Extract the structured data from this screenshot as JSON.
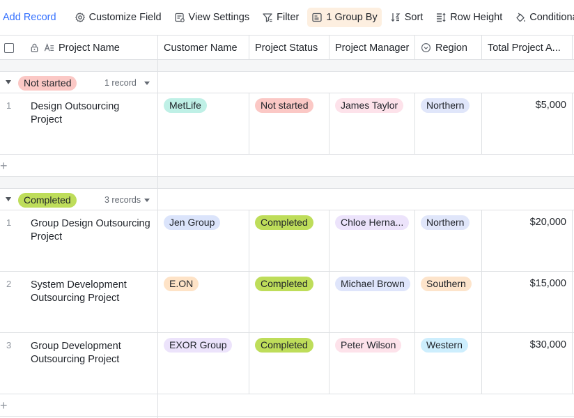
{
  "toolbar": {
    "add_record": "Add Record",
    "items": [
      {
        "label": "Customize Field",
        "icon": "gear-icon"
      },
      {
        "label": "View Settings",
        "icon": "view-settings-icon"
      },
      {
        "label": "Filter",
        "icon": "filter-icon"
      },
      {
        "label": "1 Group By",
        "icon": "group-icon",
        "active": true
      },
      {
        "label": "Sort",
        "icon": "sort-icon"
      },
      {
        "label": "Row Height",
        "icon": "row-height-icon"
      },
      {
        "label": "Conditional C",
        "icon": "paint-bucket-icon"
      }
    ]
  },
  "columns": [
    "Project Name",
    "Customer Name",
    "Project Status",
    "Project Manager",
    "Region",
    "Total Project A..."
  ],
  "colors": {
    "accent": "#3370ff",
    "not_started": "#fbc8c5",
    "completed": "#bedd5a",
    "metlife": "#bff0e6",
    "jen": "#dbe4fb",
    "eon": "#fee3c7",
    "exor": "#ece3fb",
    "person_pink": "#fde2ea",
    "person_blue": "#dfe5fb",
    "northern": "#e0e6fa",
    "southern": "#fde4cb",
    "western": "#cdeefd",
    "group_active_bg": "#fdefe0"
  },
  "groups": [
    {
      "label": "Not started",
      "count": "1 record",
      "rows": [
        {
          "num": "1",
          "name": "Design Outsourcing Project",
          "customer": "MetLife",
          "status": "Not started",
          "manager": "James Taylor",
          "region": "Northern",
          "amount": "$5,000"
        }
      ]
    },
    {
      "label": "Completed",
      "count": "3 records",
      "rows": [
        {
          "num": "1",
          "name": "Group Design Outsourcing Project",
          "customer": "Jen Group",
          "status": "Completed",
          "manager": "Chloe Herna...",
          "region": "Northern",
          "amount": "$20,000"
        },
        {
          "num": "2",
          "name": "System Development Outsourcing Project",
          "customer": "E.ON",
          "status": "Completed",
          "manager": "Michael Brown",
          "region": "Southern",
          "amount": "$15,000"
        },
        {
          "num": "3",
          "name": "Group Development Outsourcing Project",
          "customer": "EXOR Group",
          "status": "Completed",
          "manager": "Peter Wilson",
          "region": "Western",
          "amount": "$30,000"
        }
      ]
    }
  ],
  "add_symbol": "+"
}
